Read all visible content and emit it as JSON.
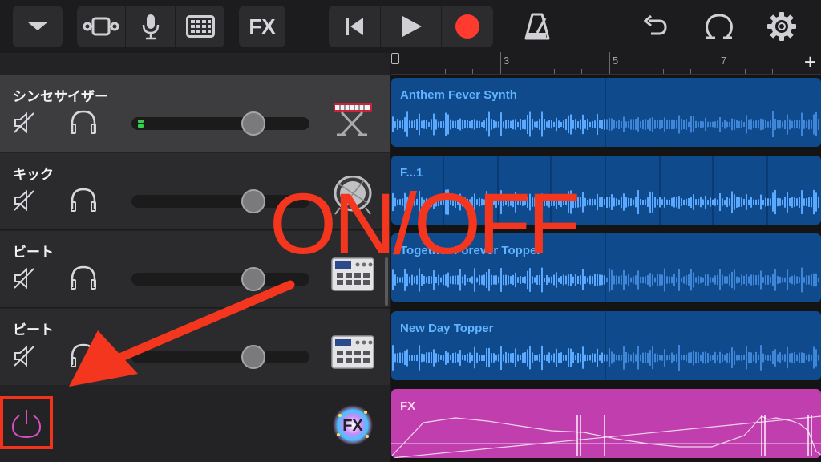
{
  "toolbar": {
    "fx_label": "FX",
    "buttons": [
      "browser-dropdown",
      "smart-controls",
      "microphone",
      "tracks-grid",
      "fx",
      "rewind",
      "play",
      "record",
      "metronome",
      "undo",
      "loop-browser",
      "settings"
    ]
  },
  "ruler": {
    "labels": [
      "3",
      "5",
      "7"
    ]
  },
  "tracks": [
    {
      "name": "シンセサイザー",
      "volume": 0.69,
      "meter_active": true,
      "instrument_icon": "keyboard-icon",
      "selected": true
    },
    {
      "name": "キック",
      "volume": 0.69,
      "meter_active": false,
      "instrument_icon": "drum-icon",
      "selected": false
    },
    {
      "name": "ビート",
      "volume": 0.69,
      "meter_active": false,
      "instrument_icon": "drum-machine-icon",
      "selected": false
    },
    {
      "name": "ビート",
      "volume": 0.69,
      "meter_active": false,
      "instrument_icon": "drum-machine-icon",
      "selected": false
    }
  ],
  "fx_track": {
    "badge_label": "FX",
    "power_icon": "power-icon"
  },
  "regions": [
    {
      "title": "Anthem Fever Synth"
    },
    {
      "title": "F...1"
    },
    {
      "title": "Together Forever Topper"
    },
    {
      "title": "New Day Topper"
    },
    {
      "title": "FX"
    }
  ],
  "annotation": {
    "text": "ON/OFF",
    "color": "#f4361f"
  },
  "colors": {
    "region_blue": "#0f4a8c",
    "waveform_blue": "#5aa9ff",
    "fx_magenta": "#c13eae",
    "record_red": "#ff3b30",
    "highlight_red": "#f2331c",
    "meter_green": "#33d14a"
  }
}
